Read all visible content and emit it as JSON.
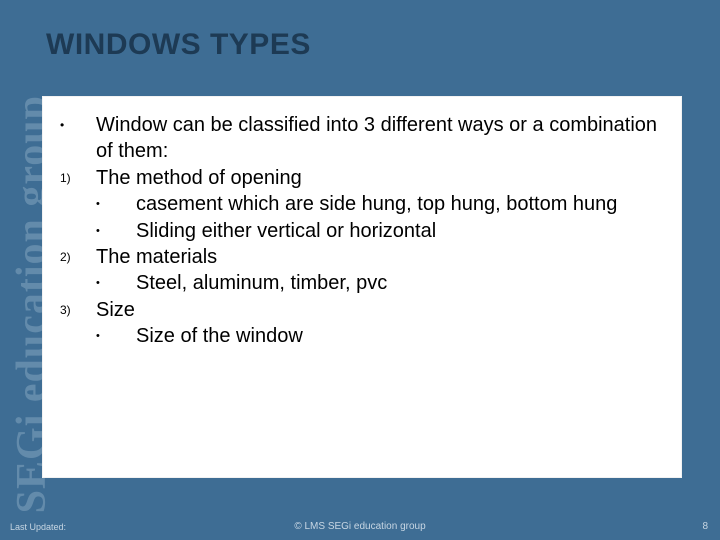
{
  "watermark": "SEGi education group",
  "title": "WINDOWS TYPES",
  "content": {
    "intro_marker": "•",
    "intro": "Window can be classified into 3 different ways or a combination of them:",
    "m1": "1)",
    "item1": "The method of opening",
    "sub1a_marker": "•",
    "sub1a": "casement which are side hung, top hung, bottom hung",
    "sub1b_marker": "•",
    "sub1b": "Sliding either vertical or horizontal",
    "m2": "2)",
    "item2": "The materials",
    "sub2a_marker": "•",
    "sub2a": "Steel, aluminum, timber, pvc",
    "m3": "3)",
    "item3": "Size",
    "sub3a_marker": "•",
    "sub3a": "Size of the window"
  },
  "footer": {
    "left": "Last Updated:",
    "center": "© LMS SEGi education group",
    "right": "8"
  }
}
